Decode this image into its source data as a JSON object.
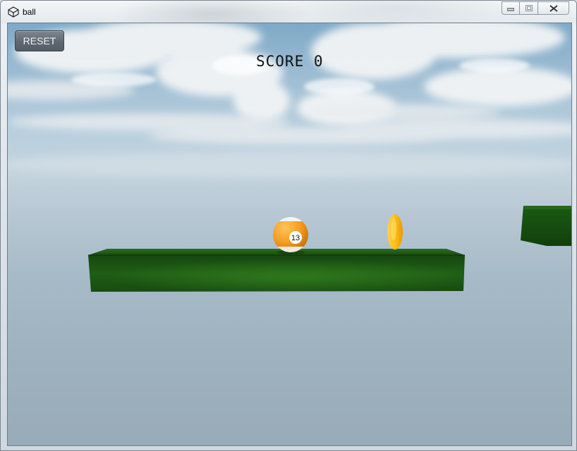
{
  "window": {
    "title": "ball",
    "icon": "unity-icon",
    "buttons": [
      "minimize-icon",
      "restore-icon",
      "close-icon"
    ]
  },
  "hud": {
    "reset_label": "RESET",
    "score_label": "SCORE",
    "score_value": "0"
  },
  "scene": {
    "ball_number": "13",
    "colors": {
      "sky_top": "#7fa9c8",
      "horizon": "#c3d3de",
      "platform": "#1d5e14",
      "ball": "#f39a1e",
      "coin": "#ffbf18"
    }
  }
}
